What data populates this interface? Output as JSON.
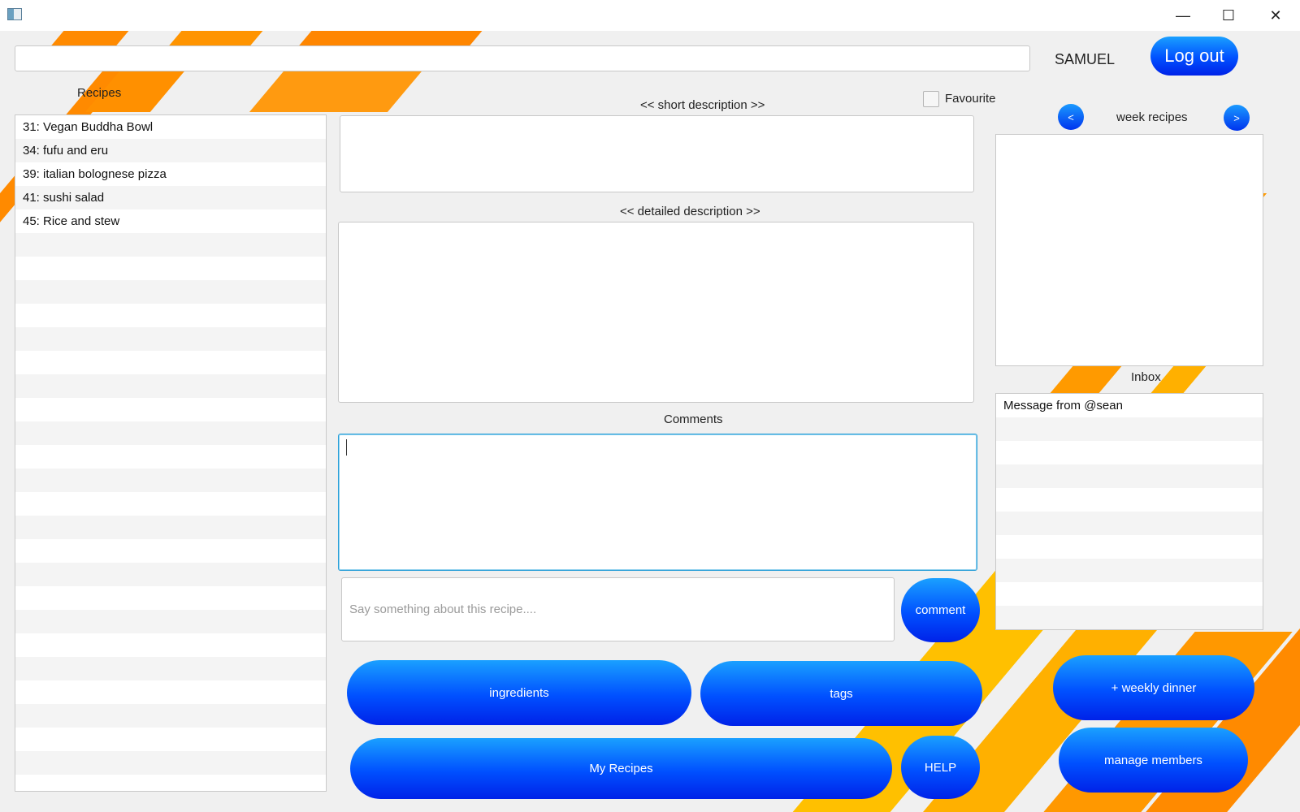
{
  "user": {
    "name": "SAMUEL",
    "logout_label": "Log out"
  },
  "recipes": {
    "label": "Recipes",
    "items": [
      "31: Vegan Buddha Bowl",
      "34: fufu and eru",
      "39: italian  bolognese pizza",
      "41: sushi salad",
      "45: Rice and stew"
    ]
  },
  "short_description": {
    "label": "<<  short description  >>"
  },
  "detailed_description": {
    "label": "<<  detailed description  >>"
  },
  "favourite": {
    "label": "Favourite"
  },
  "comments": {
    "label": "Comments"
  },
  "comment_input": {
    "placeholder": "Say something about this recipe...."
  },
  "buttons": {
    "comment": "comment",
    "ingredients": "ingredients",
    "tags": "tags",
    "my_recipes": "My Recipes",
    "help": "HELP",
    "weekly_dinner": "+ weekly dinner",
    "manage_members": "manage members"
  },
  "week": {
    "label": "week recipes",
    "prev": "<",
    "next": ">"
  },
  "inbox": {
    "label": "Inbox",
    "items": [
      "Message from @sean"
    ]
  },
  "colors": {
    "accent_blue": "#0050ff",
    "stripe_orange": "#ff8a00",
    "stripe_yellow": "#ffc000"
  }
}
